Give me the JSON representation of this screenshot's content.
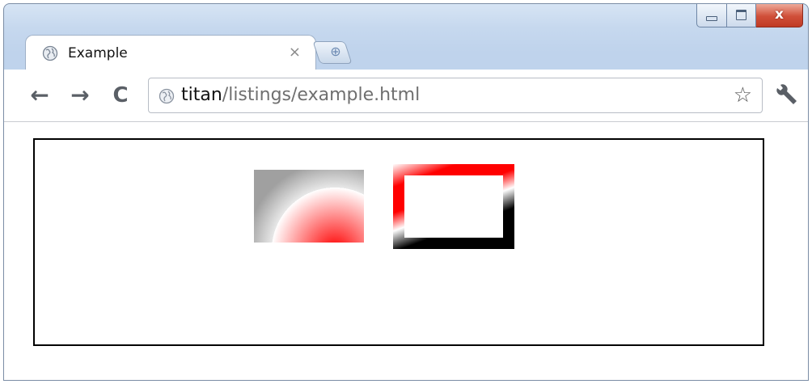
{
  "window": {
    "controls": [
      "minimize",
      "maximize",
      "close"
    ],
    "close_symbol": "x"
  },
  "tab": {
    "title": "Example",
    "close_symbol": "×",
    "icon": "globe-icon"
  },
  "toolbar": {
    "back_symbol": "←",
    "forward_symbol": "→",
    "reload_symbol": "C",
    "address": {
      "host": "titan",
      "path": "/listings/example.html"
    },
    "bookmark_symbol": "☆",
    "menu_icon": "wrench-icon"
  },
  "content": {
    "gradient_colors": [
      "#ff0000",
      "#ffffff",
      "#a0a0a0",
      "#000000"
    ]
  }
}
